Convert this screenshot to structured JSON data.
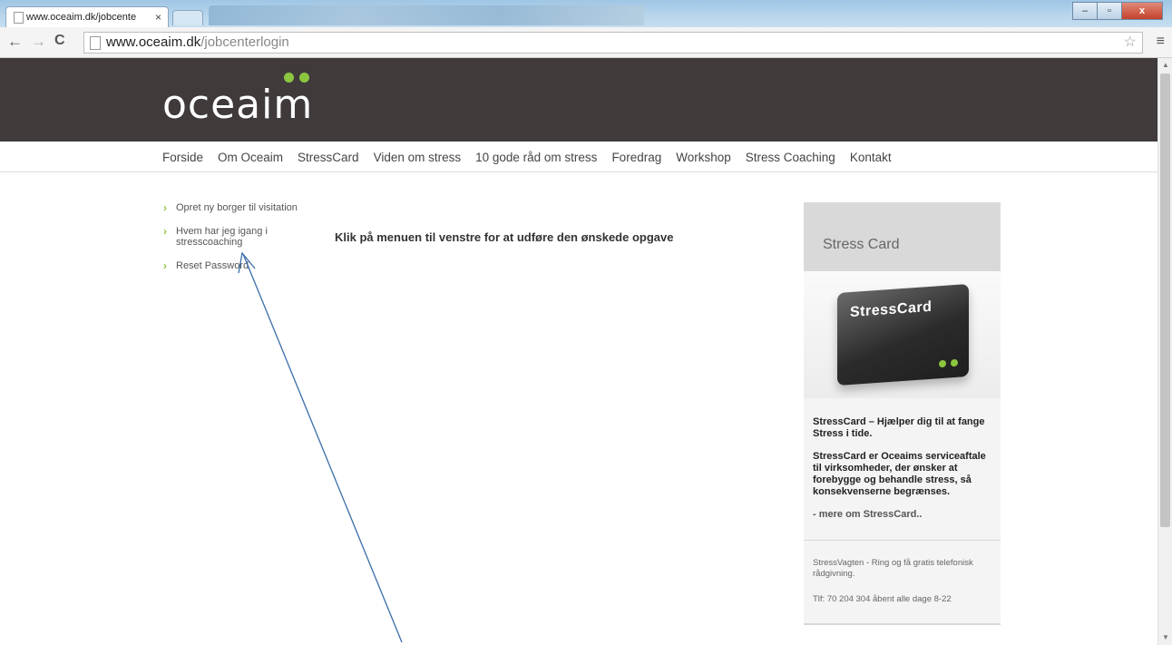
{
  "browser": {
    "tab_title": "www.oceaim.dk/jobcente",
    "tab_close": "×",
    "url_domain": "www.oceaim.dk",
    "url_path": "/jobcenterlogin",
    "back": "←",
    "forward": "→",
    "reload": "C",
    "star": "☆",
    "menu": "≡",
    "minimize": "–",
    "maximize": "▫",
    "close": "x"
  },
  "site": {
    "logo": "oceaim",
    "nav": [
      "Forside",
      "Om Oceaim",
      "StressCard",
      "Viden om stress",
      "10 gode råd om stress",
      "Foredrag",
      "Workshop",
      "Stress Coaching",
      "Kontakt"
    ],
    "side_menu": [
      "Opret ny borger til visitation",
      "Hvem har jeg igang i stresscoaching",
      "Reset Password"
    ],
    "side_arrow": "›",
    "main_message": "Klik på menuen til venstre for at udføre den ønskede opgave"
  },
  "widget": {
    "title": "Stress Card",
    "card_text": "StressCard",
    "headline": "StressCard – Hjælper dig til at fange Stress i tide.",
    "body": "StressCard er Oceaims serviceaftale til virksomheder, der ønsker at forebygge og behandle stress, så konsekvenserne begrænses.",
    "more_link": "- mere om StressCard..",
    "stressvagten": "StressVagten - Ring og få gratis telefonisk rådgivning.",
    "phone": "Tlf: 70 204 304 åbent alle dage 8-22"
  },
  "colors": {
    "header_bg": "#403a3b",
    "accent_green": "#8cc63f",
    "annotation_arrow": "#3a6ea8"
  }
}
